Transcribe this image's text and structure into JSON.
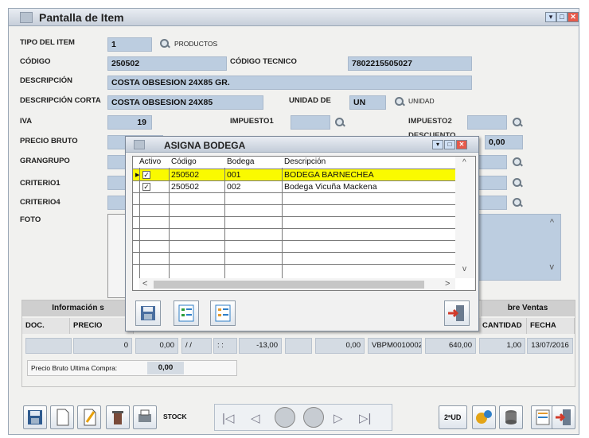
{
  "window": {
    "title": "Pantalla de Item"
  },
  "form": {
    "tipo_label": "TIPO DEL ITEM",
    "tipo_value": "1",
    "tipo_link": "PRODUCTOS",
    "codigo_label": "CÓDIGO",
    "codigo_value": "250502",
    "codigo_tecnico_label": "CÓDIGO TECNICO",
    "codigo_tecnico_value": "7802215505027",
    "descripcion_label": "DESCRIPCIÓN",
    "descripcion_value": "COSTA OBSESION 24X85 GR.",
    "descripcion_corta_label": "DESCRIPCIÓN CORTA",
    "descripcion_corta_value": "COSTA OBSESION 24X85",
    "unidad_label": "UNIDAD DE",
    "unidad_value": "UN",
    "unidad_link": "UNIDAD",
    "iva_label": "IVA",
    "iva_value": "19",
    "impuesto1_label": "IMPUESTO1",
    "impuesto2_label": "IMPUESTO2",
    "precio_bruto_label": "PRECIO BRUTO",
    "descuento_label": "DESCUENTO",
    "descuento_value": "0,00",
    "grangrupo_label": "GRANGRUPO",
    "criterio1_label": "CRITERIO1",
    "criterio4_label": "CRITERIO4",
    "foto_label": "FOTO"
  },
  "info_section": {
    "compras_header": "Información s",
    "ventas_header": "bre Ventas",
    "col_doc": "DOC.",
    "col_precio": "PRECIO",
    "col_cantidad": "CANTIDAD",
    "col_fecha": "FECHA",
    "row": {
      "doc": "",
      "precio": "0",
      "c3": "0,00",
      "c4": "/ /",
      "c5": ": :",
      "c6": "-13,00",
      "c7": "",
      "c8": "0,00",
      "c9": "VBPM0010002",
      "c10": "640,00",
      "cantidad": "1,00",
      "fecha": "13/07/2016"
    },
    "last_buy_label": "Precio Bruto Ultima Compra:",
    "last_buy_value": "0,00"
  },
  "toolbar": {
    "stock_label": "STOCK",
    "ud_label": "2ªUD"
  },
  "dialog": {
    "title": "ASIGNA BODEGA",
    "columns": [
      "Activo",
      "Código",
      "Bodega",
      "Descripción"
    ],
    "rows": [
      {
        "activo": true,
        "codigo": "250502",
        "bodega": "001",
        "descripcion": "BODEGA BARNECHEA"
      },
      {
        "activo": true,
        "codigo": "250502",
        "bodega": "002",
        "descripcion": "Bodega Vicuña Mackena"
      }
    ]
  },
  "colors": {
    "field_bg": "#bccde0",
    "selected_row": "#fafa00",
    "close_red": "#e65a4a"
  }
}
